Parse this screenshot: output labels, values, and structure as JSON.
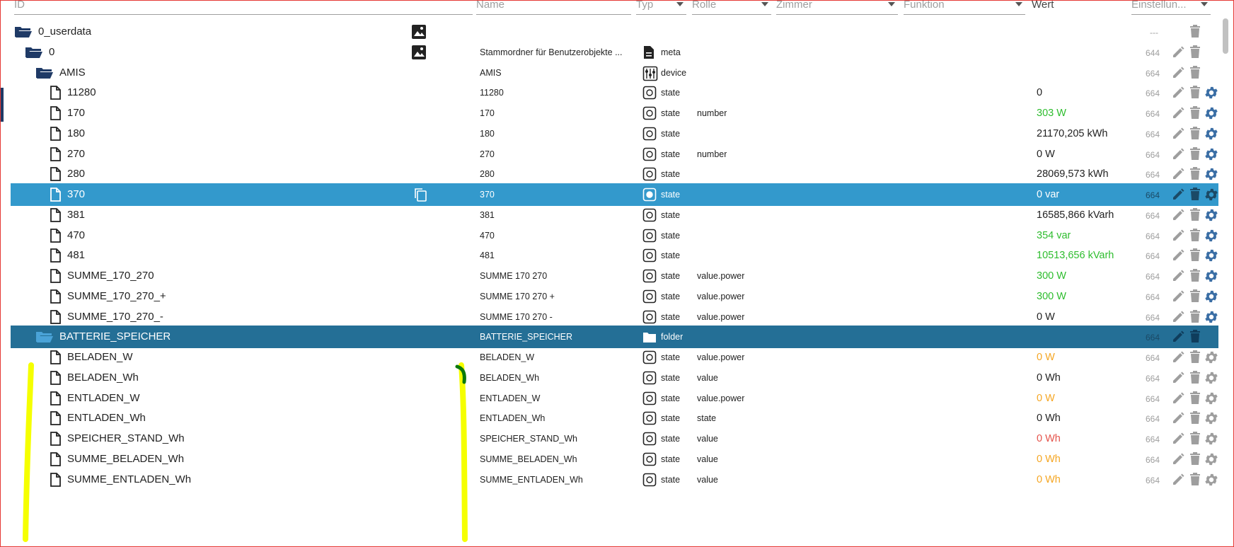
{
  "header": {
    "id_placeholder": "ID",
    "name_placeholder": "Name",
    "type_label": "Typ",
    "role_label": "Rolle",
    "room_label": "Zimmer",
    "function_label": "Funktion",
    "value_label": "Wert",
    "settings_label": "Einstellun..."
  },
  "colors": {
    "folder": "#1f3a66",
    "selected": "#3399cc",
    "selected_folder": "#246f96",
    "value_green": "#2ebd2e",
    "value_orange": "#f5a623",
    "value_red": "#e5534b"
  },
  "root_perm": "---",
  "rows": [
    {
      "id": "0_userdata",
      "name": "",
      "type": "",
      "type_icon": "none",
      "role": "",
      "value": "",
      "perm": "---",
      "kind": "folder-open",
      "level": 0
    },
    {
      "id": "0",
      "name": "Stammordner für Benutzerobjekte ...",
      "type": "meta",
      "type_icon": "doc-icon",
      "role": "",
      "value": "",
      "perm": "644",
      "kind": "folder-open",
      "level": 1
    },
    {
      "id": "AMIS",
      "name": "AMIS",
      "type": "device",
      "type_icon": "device-icon",
      "role": "",
      "value": "",
      "perm": "664",
      "kind": "folder-open",
      "level": 2
    },
    {
      "id": "11280",
      "name": "11280",
      "type": "state",
      "type_icon": "state-icon",
      "role": "",
      "value": "0",
      "value_color": "default",
      "perm": "664",
      "kind": "file",
      "level": 3
    },
    {
      "id": "170",
      "name": "170",
      "type": "state",
      "type_icon": "state-icon",
      "role": "number",
      "value": "303 W",
      "value_color": "green",
      "perm": "664",
      "kind": "file",
      "level": 3
    },
    {
      "id": "180",
      "name": "180",
      "type": "state",
      "type_icon": "state-icon",
      "role": "",
      "value": "21170,205 kWh",
      "value_color": "default",
      "perm": "664",
      "kind": "file",
      "level": 3
    },
    {
      "id": "270",
      "name": "270",
      "type": "state",
      "type_icon": "state-icon",
      "role": "number",
      "value": "0 W",
      "value_color": "default",
      "perm": "664",
      "kind": "file",
      "level": 3
    },
    {
      "id": "280",
      "name": "280",
      "type": "state",
      "type_icon": "state-icon",
      "role": "",
      "value": "28069,573 kWh",
      "value_color": "default",
      "perm": "664",
      "kind": "file",
      "level": 3
    },
    {
      "id": "370",
      "name": "370",
      "type": "state",
      "type_icon": "state-icon",
      "role": "",
      "value": "0 var",
      "value_color": "white",
      "perm": "664",
      "kind": "file",
      "level": 3,
      "selected": "row"
    },
    {
      "id": "381",
      "name": "381",
      "type": "state",
      "type_icon": "state-icon",
      "role": "",
      "value": "16585,866 kVarh",
      "value_color": "default",
      "perm": "664",
      "kind": "file",
      "level": 3
    },
    {
      "id": "470",
      "name": "470",
      "type": "state",
      "type_icon": "state-icon",
      "role": "",
      "value": "354 var",
      "value_color": "green",
      "perm": "664",
      "kind": "file",
      "level": 3
    },
    {
      "id": "481",
      "name": "481",
      "type": "state",
      "type_icon": "state-icon",
      "role": "",
      "value": "10513,656 kVarh",
      "value_color": "green",
      "perm": "664",
      "kind": "file",
      "level": 3
    },
    {
      "id": "SUMME_170_270",
      "name": "SUMME 170 270",
      "type": "state",
      "type_icon": "state-icon",
      "role": "value.power",
      "value": "300 W",
      "value_color": "green",
      "perm": "664",
      "kind": "file",
      "level": 3
    },
    {
      "id": "SUMME_170_270_+",
      "name": "SUMME 170 270 +",
      "type": "state",
      "type_icon": "state-icon",
      "role": "value.power",
      "value": "300 W",
      "value_color": "green",
      "perm": "664",
      "kind": "file",
      "level": 3
    },
    {
      "id": "SUMME_170_270_-",
      "name": "SUMME 170 270 -",
      "type": "state",
      "type_icon": "state-icon",
      "role": "value.power",
      "value": "0 W",
      "value_color": "default",
      "perm": "664",
      "kind": "file",
      "level": 3
    },
    {
      "id": "BATTERIE_SPEICHER",
      "name": "BATTERIE_SPEICHER",
      "type": "folder",
      "type_icon": "folder-icon",
      "role": "",
      "value": "",
      "perm": "664",
      "kind": "folder-open",
      "level": 2,
      "selected": "folder"
    },
    {
      "id": "BELADEN_W",
      "name": "BELADEN_W",
      "type": "state",
      "type_icon": "state-icon",
      "role": "value.power",
      "value": "0 W",
      "value_color": "orange",
      "perm": "664",
      "kind": "file",
      "level": 3,
      "gear": "grey"
    },
    {
      "id": "BELADEN_Wh",
      "name": "BELADEN_Wh",
      "type": "state",
      "type_icon": "state-icon",
      "role": "value",
      "value": "0 Wh",
      "value_color": "default",
      "perm": "664",
      "kind": "file",
      "level": 3,
      "gear": "grey"
    },
    {
      "id": "ENTLADEN_W",
      "name": "ENTLADEN_W",
      "type": "state",
      "type_icon": "state-icon",
      "role": "value.power",
      "value": "0 W",
      "value_color": "orange",
      "perm": "664",
      "kind": "file",
      "level": 3,
      "gear": "grey"
    },
    {
      "id": "ENTLADEN_Wh",
      "name": "ENTLADEN_Wh",
      "type": "state",
      "type_icon": "state-icon",
      "role": "state",
      "value": "0 Wh",
      "value_color": "default",
      "perm": "664",
      "kind": "file",
      "level": 3,
      "gear": "grey"
    },
    {
      "id": "SPEICHER_STAND_Wh",
      "name": "SPEICHER_STAND_Wh",
      "type": "state",
      "type_icon": "state-icon",
      "role": "value",
      "value": "0 Wh",
      "value_color": "red",
      "perm": "664",
      "kind": "file",
      "level": 3,
      "gear": "grey"
    },
    {
      "id": "SUMME_BELADEN_Wh",
      "name": "SUMME_BELADEN_Wh",
      "type": "state",
      "type_icon": "state-icon",
      "role": "value",
      "value": "0 Wh",
      "value_color": "orange",
      "perm": "664",
      "kind": "file",
      "level": 3,
      "gear": "grey"
    },
    {
      "id": "SUMME_ENTLADEN_Wh",
      "name": "SUMME_ENTLADEN_Wh",
      "type": "state",
      "type_icon": "state-icon",
      "role": "value",
      "value": "0 Wh",
      "value_color": "orange",
      "perm": "664",
      "kind": "file",
      "level": 3,
      "gear": "grey"
    }
  ]
}
